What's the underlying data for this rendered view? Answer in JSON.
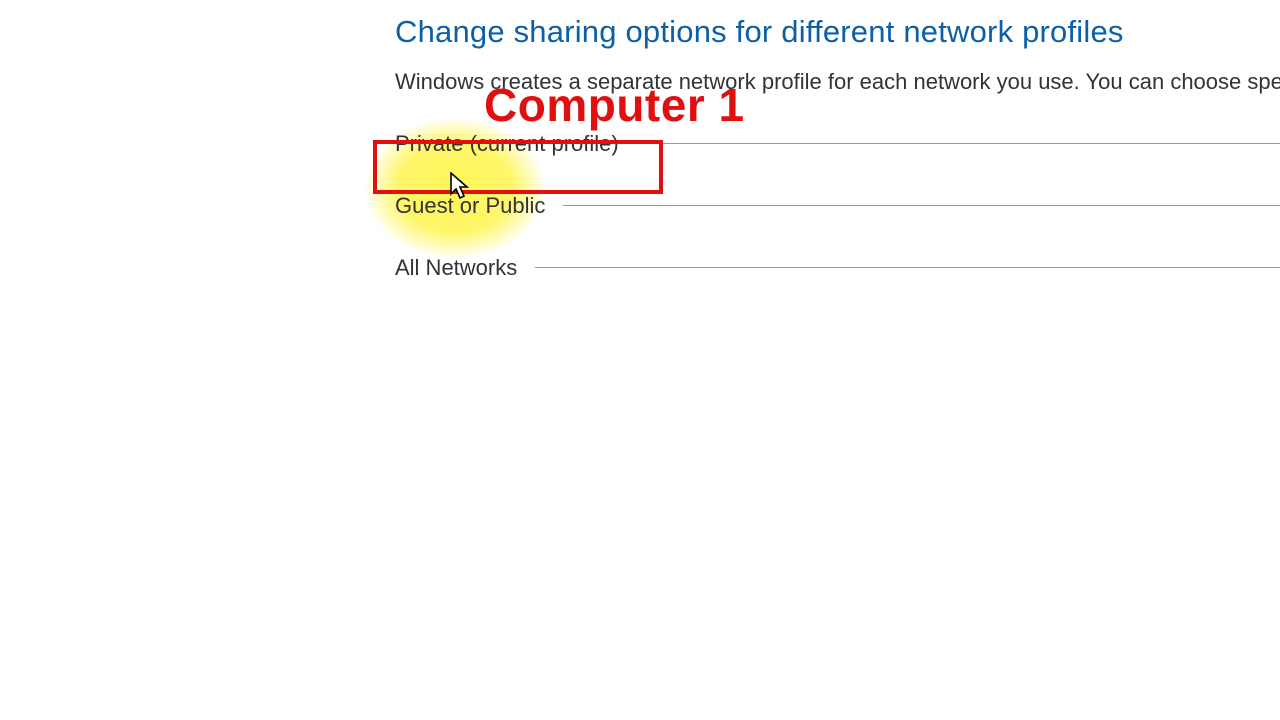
{
  "header": {
    "title": "Change sharing options for different network profiles",
    "description": "Windows creates a separate network profile for each network you use. You can choose specific options for each profile."
  },
  "profiles": [
    {
      "label": "Private (current profile)"
    },
    {
      "label": "Guest or Public"
    },
    {
      "label": "All Networks"
    }
  ],
  "annotation": {
    "label": "Computer 1"
  }
}
